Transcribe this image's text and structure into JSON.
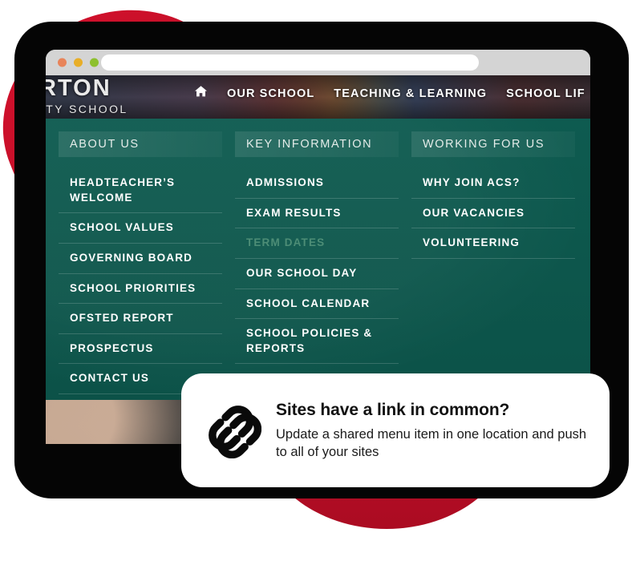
{
  "browser": {
    "traffic_lights": [
      "orange-dot",
      "yellow-dot",
      "green-dot"
    ],
    "url_value": "",
    "url_placeholder": ""
  },
  "site": {
    "logo": {
      "line1": "RTON",
      "line2": "ITY SCHOOL"
    },
    "topnav": {
      "home_icon": "home-icon",
      "items": [
        {
          "label": "OUR SCHOOL"
        },
        {
          "label": "TEACHING & LEARNING"
        },
        {
          "label": "SCHOOL LIF"
        }
      ]
    },
    "megamenu": {
      "columns": [
        {
          "heading": "ABOUT US",
          "items": [
            {
              "label": "HEADTEACHER’S WELCOME",
              "state": "normal"
            },
            {
              "label": "SCHOOL VALUES",
              "state": "normal"
            },
            {
              "label": "GOVERNING BOARD",
              "state": "normal"
            },
            {
              "label": "SCHOOL PRIORITIES",
              "state": "normal"
            },
            {
              "label": "OFSTED REPORT",
              "state": "normal"
            },
            {
              "label": "PROSPECTUS",
              "state": "normal"
            },
            {
              "label": "CONTACT US",
              "state": "normal"
            }
          ]
        },
        {
          "heading": "KEY INFORMATION",
          "items": [
            {
              "label": "ADMISSIONS",
              "state": "normal"
            },
            {
              "label": "EXAM RESULTS",
              "state": "normal"
            },
            {
              "label": "TERM DATES",
              "state": "dim"
            },
            {
              "label": "OUR SCHOOL DAY",
              "state": "normal"
            },
            {
              "label": "SCHOOL CALENDAR",
              "state": "normal"
            },
            {
              "label": "SCHOOL POLICIES & REPORTS",
              "state": "normal"
            }
          ]
        },
        {
          "heading": "WORKING FOR US",
          "items": [
            {
              "label": "WHY JOIN ACS?",
              "state": "normal"
            },
            {
              "label": "OUR VACANCIES",
              "state": "normal"
            },
            {
              "label": "VOLUNTEERING",
              "state": "normal"
            }
          ]
        }
      ]
    }
  },
  "callout": {
    "icon": "chain-link-icon",
    "title": "Sites have a link in common?",
    "body": "Update a shared menu item in one location and push to all of your sites"
  },
  "colors": {
    "menu_green": "#0d5a4f",
    "menu_green_header": "#19675b",
    "dim_link_green": "#4d8d76",
    "accent_red": "#c3102b",
    "device_black": "#050505",
    "chrome_grey": "#d4d4d4",
    "card_white": "#ffffff",
    "dot_orange": "#e8845a",
    "dot_yellow": "#e8ae28",
    "dot_green": "#8dc02e"
  }
}
